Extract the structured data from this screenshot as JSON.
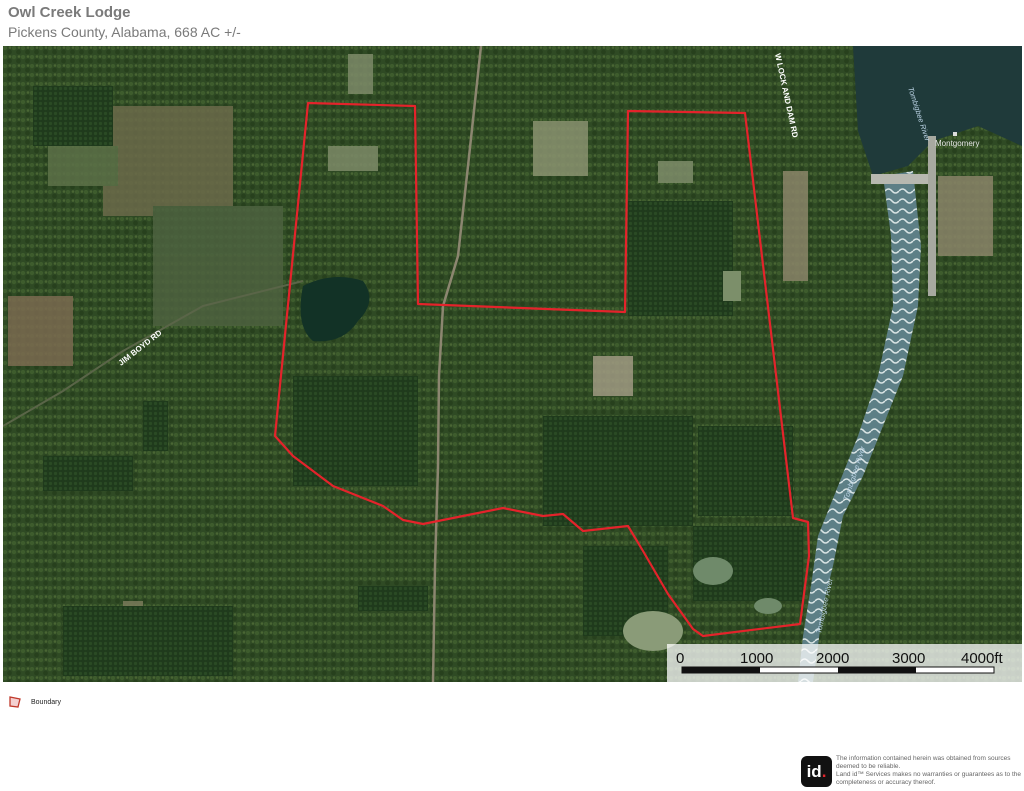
{
  "header": {
    "title": "Owl Creek Lodge",
    "subtitle": "Pickens County, Alabama, 668 AC +/-"
  },
  "map": {
    "imagery": "satellite",
    "boundary_color": "#e4232b",
    "labels": {
      "road_west": "JIM BOYD RD",
      "road_north": "W LOCK AND DAM RD",
      "river_north": "Tombigbee River",
      "river_mid": "Tombigbee River",
      "river_south": "Tombigbee River",
      "town": "Montgomery"
    },
    "scale_bar": {
      "ticks": [
        "0",
        "1000",
        "2000",
        "3000",
        "4000ft"
      ]
    }
  },
  "legend": {
    "boundary_label": "Boundary",
    "boundary_icon": "boundary-polygon-icon"
  },
  "footer": {
    "logo_text": "id",
    "disclaimer": [
      "The information contained herein was obtained from sources",
      "deemed to be reliable.",
      "Land id™ Services makes no warranties or guarantees as to the",
      "completeness or accuracy thereof."
    ]
  }
}
